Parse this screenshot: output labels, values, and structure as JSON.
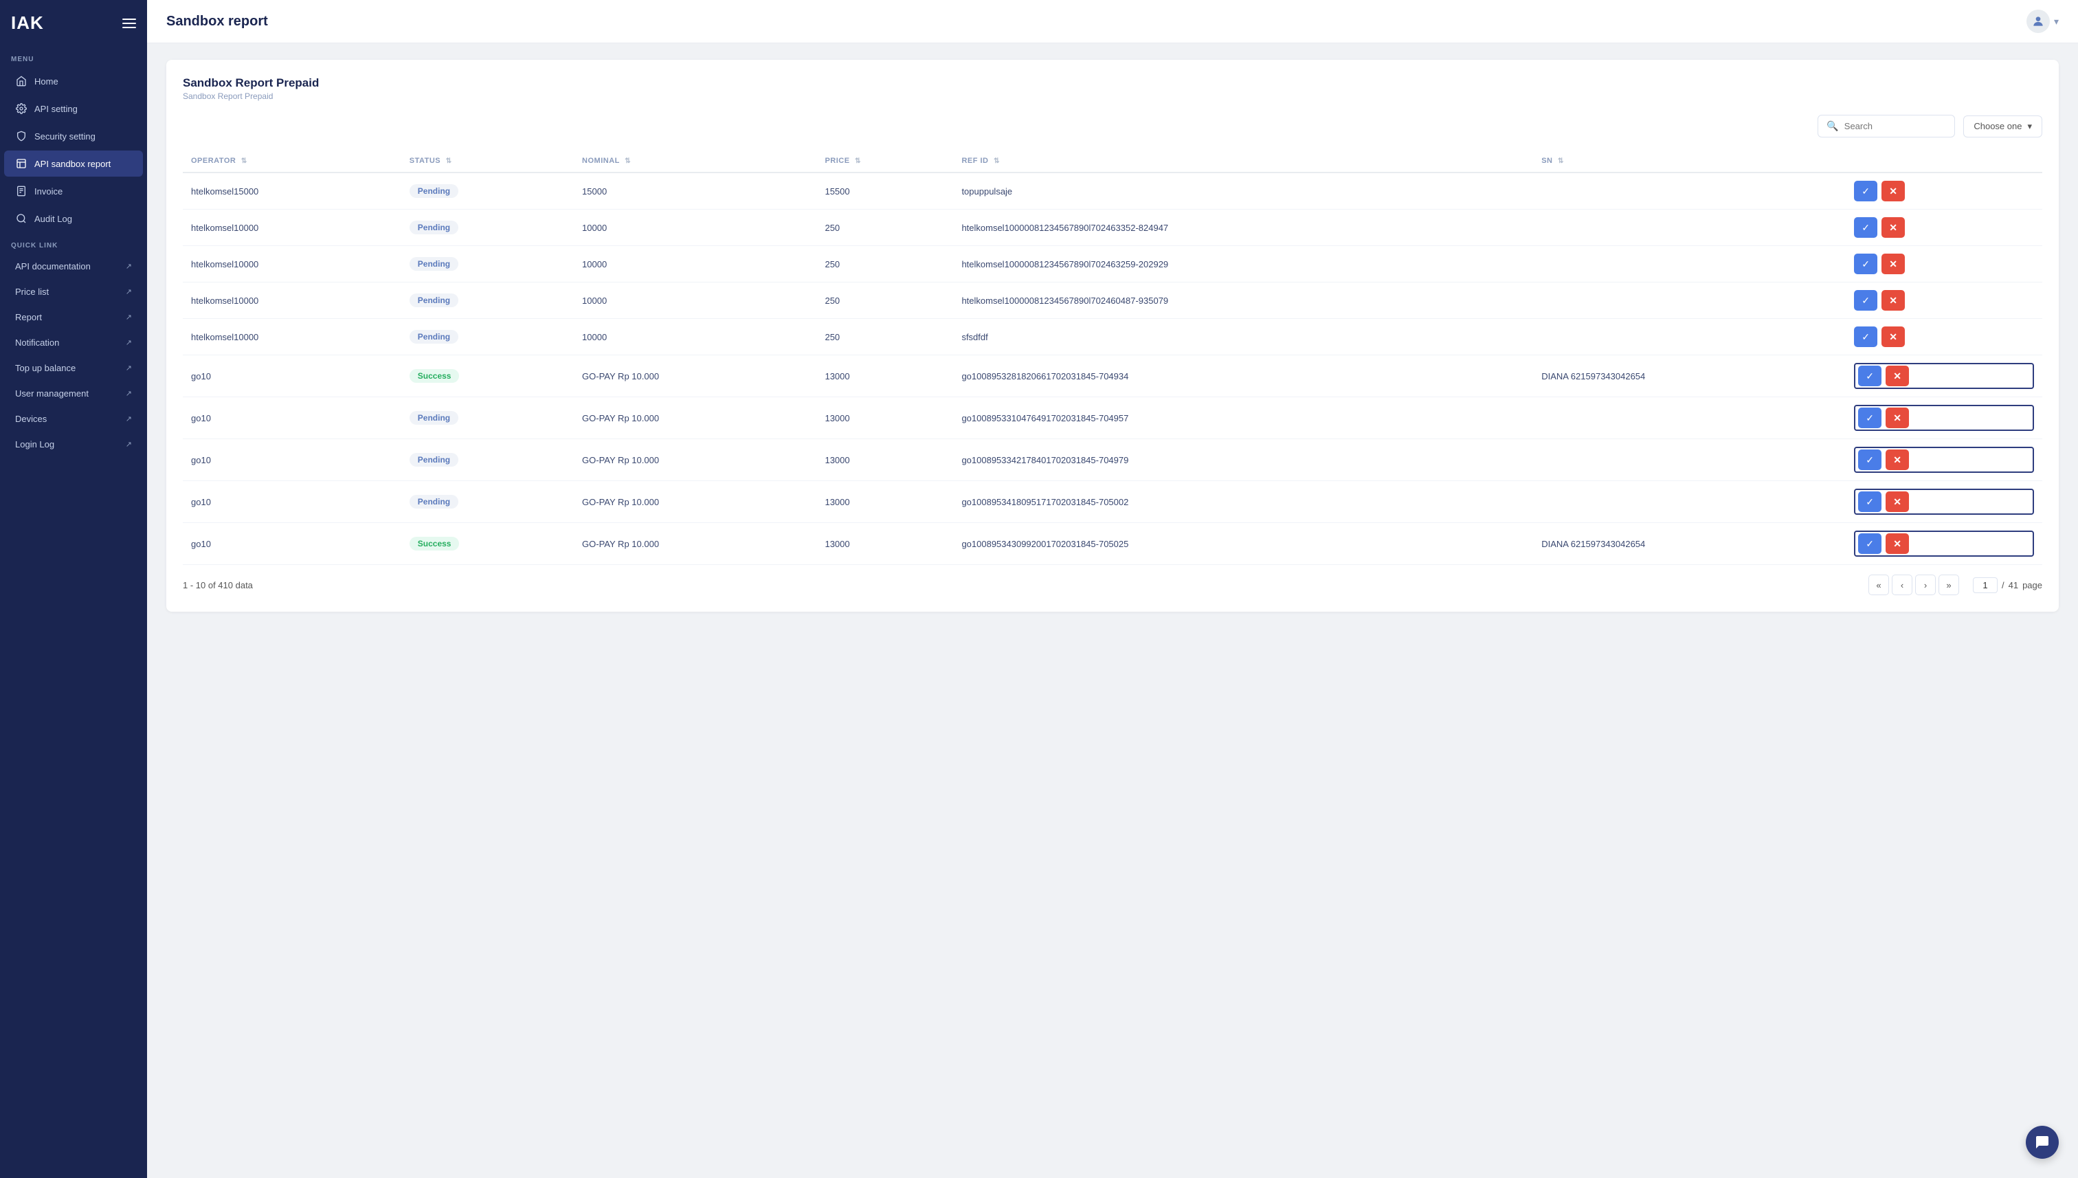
{
  "sidebar": {
    "logo": "IAK",
    "menu_label": "MENU",
    "quick_link_label": "QUICK LINK",
    "items": [
      {
        "id": "home",
        "label": "Home",
        "icon": "home",
        "active": false
      },
      {
        "id": "api-setting",
        "label": "API setting",
        "icon": "gear",
        "active": false
      },
      {
        "id": "security-setting",
        "label": "Security setting",
        "icon": "shield",
        "active": false
      },
      {
        "id": "api-sandbox-report",
        "label": "API sandbox report",
        "icon": "file",
        "active": true
      }
    ],
    "other_items": [
      {
        "id": "invoice",
        "label": "Invoice",
        "icon": "invoice"
      },
      {
        "id": "audit-log",
        "label": "Audit Log",
        "icon": "audit"
      }
    ],
    "quick_links": [
      {
        "id": "api-documentation",
        "label": "API documentation",
        "ext": true
      },
      {
        "id": "price-list",
        "label": "Price list",
        "ext": true
      },
      {
        "id": "report",
        "label": "Report",
        "ext": true
      },
      {
        "id": "notification",
        "label": "Notification",
        "ext": true
      },
      {
        "id": "top-up-balance",
        "label": "Top up balance",
        "ext": true
      },
      {
        "id": "user-management",
        "label": "User management",
        "ext": true
      },
      {
        "id": "devices",
        "label": "Devices",
        "ext": true
      },
      {
        "id": "login-log",
        "label": "Login Log",
        "ext": true
      }
    ]
  },
  "header": {
    "title": "Sandbox report",
    "avatar_icon": "👤"
  },
  "card": {
    "title": "Sandbox Report Prepaid",
    "subtitle": "Sandbox Report Prepaid"
  },
  "toolbar": {
    "search_placeholder": "Search",
    "dropdown_label": "Choose one"
  },
  "table": {
    "columns": [
      {
        "key": "operator",
        "label": "OPERATOR"
      },
      {
        "key": "status",
        "label": "STATUS"
      },
      {
        "key": "nominal",
        "label": "NOMINAL"
      },
      {
        "key": "price",
        "label": "PRICE"
      },
      {
        "key": "ref_id",
        "label": "REF ID"
      },
      {
        "key": "sn",
        "label": "SN"
      }
    ],
    "rows": [
      {
        "operator": "htelkomsel15000",
        "status": "Pending",
        "status_type": "pending",
        "nominal": "15000",
        "price": "15500",
        "ref_id": "topuppulsaje",
        "sn": ""
      },
      {
        "operator": "htelkomsel10000",
        "status": "Pending",
        "status_type": "pending",
        "nominal": "10000",
        "price": "250",
        "ref_id": "htelkomsel10000081234567890l702463352-824947",
        "sn": ""
      },
      {
        "operator": "htelkomsel10000",
        "status": "Pending",
        "status_type": "pending",
        "nominal": "10000",
        "price": "250",
        "ref_id": "htelkomsel10000081234567890l702463259-202929",
        "sn": ""
      },
      {
        "operator": "htelkomsel10000",
        "status": "Pending",
        "status_type": "pending",
        "nominal": "10000",
        "price": "250",
        "ref_id": "htelkomsel10000081234567890l702460487-935079",
        "sn": ""
      },
      {
        "operator": "htelkomsel10000",
        "status": "Pending",
        "status_type": "pending",
        "nominal": "10000",
        "price": "250",
        "ref_id": "sfsdfdf",
        "sn": ""
      },
      {
        "operator": "go10",
        "status": "Success",
        "status_type": "success",
        "nominal": "GO-PAY Rp 10.000",
        "price": "13000",
        "ref_id": "go1008953281820661702031845-704934",
        "sn": "DIANA 621597343042654"
      },
      {
        "operator": "go10",
        "status": "Pending",
        "status_type": "pending",
        "nominal": "GO-PAY Rp 10.000",
        "price": "13000",
        "ref_id": "go1008953310476491702031845-704957",
        "sn": ""
      },
      {
        "operator": "go10",
        "status": "Pending",
        "status_type": "pending",
        "nominal": "GO-PAY Rp 10.000",
        "price": "13000",
        "ref_id": "go1008953342178401702031845-704979",
        "sn": ""
      },
      {
        "operator": "go10",
        "status": "Pending",
        "status_type": "pending",
        "nominal": "GO-PAY Rp 10.000",
        "price": "13000",
        "ref_id": "go1008953418095171702031845-705002",
        "sn": ""
      },
      {
        "operator": "go10",
        "status": "Success",
        "status_type": "success",
        "nominal": "GO-PAY Rp 10.000",
        "price": "13000",
        "ref_id": "go1008953430992001702031845-705025",
        "sn": "DIANA 621597343042654"
      }
    ]
  },
  "pagination": {
    "range_text": "1 - 10 of 410 data",
    "current_page": "1",
    "total_pages": "41",
    "page_label": "page"
  },
  "colors": {
    "sidebar_bg": "#1a2550",
    "active_item": "#2e3d7e",
    "accent_blue": "#4a7de8",
    "accent_red": "#e74c3c",
    "success_green": "#27ae60"
  }
}
